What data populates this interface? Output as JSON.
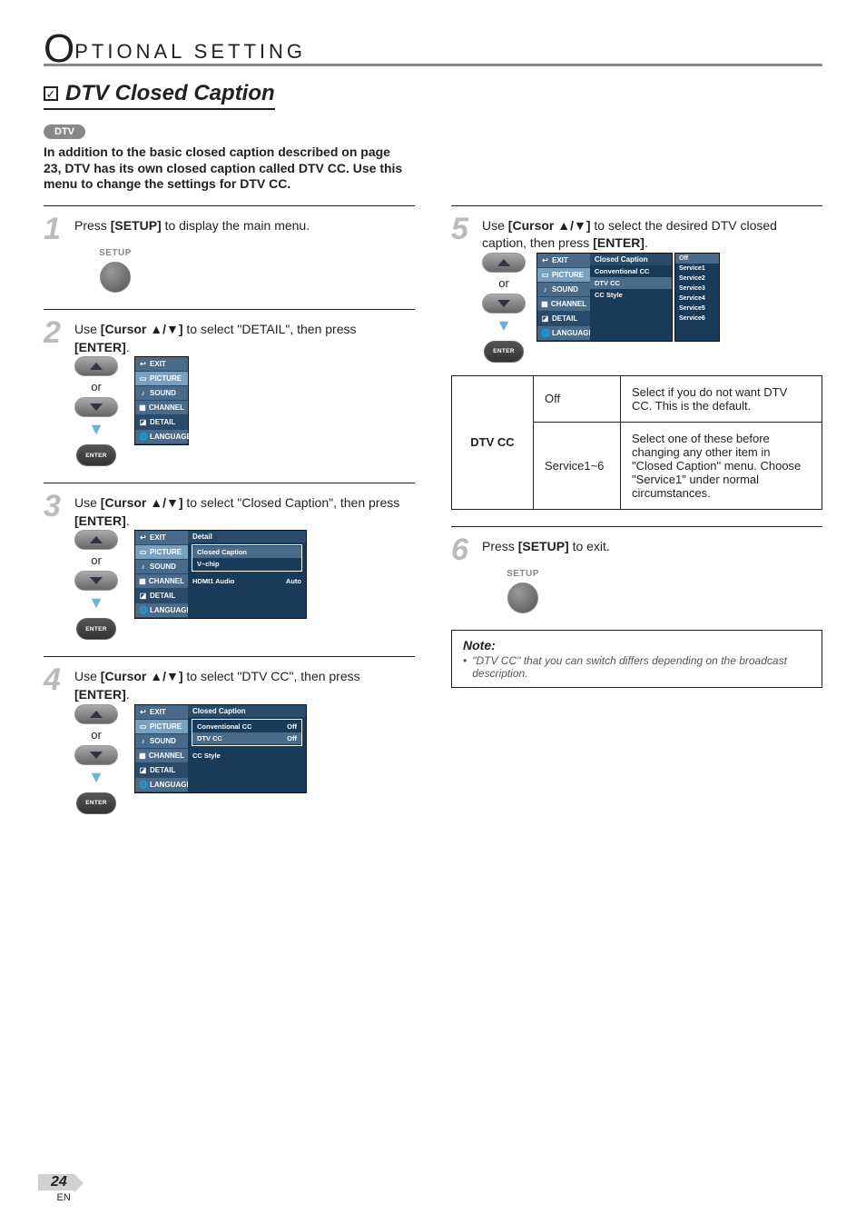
{
  "header": {
    "big_letter": "O",
    "rest": "PTIONAL   SETTING"
  },
  "section": {
    "checkmark": "✓",
    "title": "DTV Closed Caption"
  },
  "badge": "DTV",
  "intro": "In addition to the basic closed caption described on page 23, DTV has its own closed caption called DTV CC. Use this menu to change the settings for DTV CC.",
  "steps": {
    "s1": {
      "num": "1",
      "text_a": "Press ",
      "btn": "[SETUP]",
      "text_b": " to display the main menu."
    },
    "s2": {
      "num": "2",
      "text_a": "Use ",
      "btn": "[Cursor ▲/▼]",
      "text_b": " to select \"DETAIL\", then press ",
      "btn2": "[ENTER]",
      "text_c": "."
    },
    "s3": {
      "num": "3",
      "text_a": "Use ",
      "btn": "[Cursor ▲/▼]",
      "text_b": " to select \"Closed Caption\", then press ",
      "btn2": "[ENTER]",
      "text_c": "."
    },
    "s4": {
      "num": "4",
      "text_a": "Use ",
      "btn": "[Cursor ▲/▼]",
      "text_b": " to select \"DTV CC\", then press ",
      "btn2": "[ENTER]",
      "text_c": "."
    },
    "s5": {
      "num": "5",
      "text_a": "Use ",
      "btn": "[Cursor ▲/▼]",
      "text_b": " to select the desired DTV closed caption, then press ",
      "btn2": "[ENTER]",
      "text_c": "."
    },
    "s6": {
      "num": "6",
      "text_a": "Press ",
      "btn": "[SETUP]",
      "text_b": " to exit."
    }
  },
  "remote": {
    "setup_label": "SETUP",
    "or": "or",
    "enter": "ENTER"
  },
  "osd": {
    "left_items": [
      {
        "icon": "↩",
        "label": "EXIT"
      },
      {
        "icon": "▭",
        "label": "PICTURE"
      },
      {
        "icon": "♪",
        "label": "SOUND"
      },
      {
        "icon": "▦",
        "label": "CHANNEL"
      },
      {
        "icon": "◪",
        "label": "DETAIL"
      },
      {
        "icon": "🌐",
        "label": "LANGUAGE"
      }
    ],
    "detail_panel": {
      "header": "Detail",
      "rows": [
        {
          "k": "Closed Caption",
          "v": "",
          "sel": true,
          "boxed": true
        },
        {
          "k": "V–chip",
          "v": "",
          "boxed": true
        },
        {
          "k": "HDMI1 Audio",
          "v": "Auto"
        }
      ]
    },
    "cc_panel": {
      "header": "Closed Caption",
      "rows": [
        {
          "k": "Conventional CC",
          "v": "Off",
          "boxed": true
        },
        {
          "k": "DTV CC",
          "v": "Off",
          "sel": true,
          "boxed": true
        },
        {
          "k": "CC Style",
          "v": ""
        }
      ]
    },
    "cc_panel_5": {
      "header": "Closed Caption",
      "rows": [
        {
          "k": "Conventional CC",
          "v": ""
        },
        {
          "k": "DTV CC",
          "v": "",
          "sel": true
        },
        {
          "k": "CC Style",
          "v": ""
        }
      ]
    },
    "options": [
      "Off",
      "Service1",
      "Service2",
      "Service3",
      "Service4",
      "Service5",
      "Service6"
    ]
  },
  "info_table": {
    "label": "DTV CC",
    "r1_opt": "Off",
    "r1_desc": "Select if you do not want DTV CC. This is the default.",
    "r2_opt": "Service1~6",
    "r2_desc": "Select one of these before changing any other item in \"Closed Caption\" menu. Choose \"Service1\" under normal circumstances."
  },
  "note": {
    "title": "Note:",
    "bullet": "•",
    "body": "\"DTV CC\" that you can switch differs depending on the broadcast description."
  },
  "footer": {
    "page": "24",
    "lang": "EN"
  }
}
